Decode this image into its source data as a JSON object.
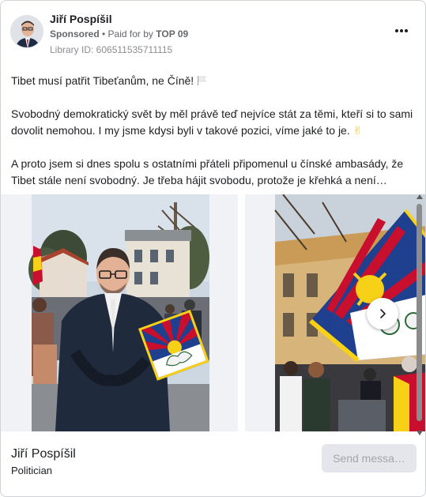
{
  "ad": {
    "page_name": "Jiří Pospíšil",
    "sponsored_label": "Sponsored",
    "separator": " • ",
    "paid_for_prefix": "Paid for by ",
    "payer": "TOP 09",
    "library_id": "Library ID: 606511535711115",
    "more_icon": "more-horizontal-icon"
  },
  "body": {
    "line1": "Tibet musí patřit Tibeťanům, ne Číně!",
    "line2": "Svobodný demokratický svět by měl právě teď nejvíce stát za těmi, kteří si to sami dovolit nemohou. I my jsme kdysi byli v takové pozici, víme jaké to je.",
    "line2_emoji": "✌",
    "line3": "A proto jsem si dnes spolu s ostatními přáteli připomenul u čínské ambasády, že Tibet stále není svobodný. Je třeba hájit svobodu, protože je křehká a není…"
  },
  "carousel": {
    "next_icon": "chevron-right-icon"
  },
  "footer": {
    "name": "Jiří Pospíšil",
    "category": "Politician",
    "cta_label": "Send messa…"
  },
  "colors": {
    "text": "#1c1e21",
    "secondary": "#65676b",
    "cta_bg": "#e4e6eb",
    "cta_text": "#a2a5aa",
    "tibet_red": "#c8102e",
    "tibet_blue": "#1f3f8f",
    "tibet_yellow": "#f7d117"
  }
}
